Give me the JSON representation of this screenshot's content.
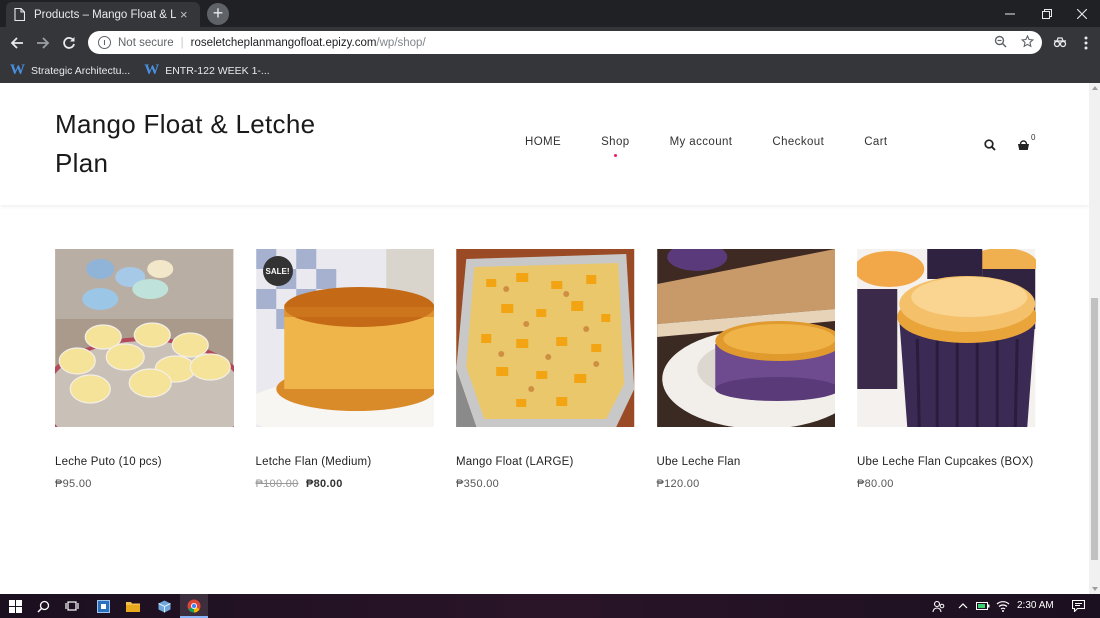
{
  "browser": {
    "tab_title": "Products – Mango Float & Letche Plan",
    "tab_close": "×",
    "new_tab": "+",
    "not_secure": "Not secure",
    "url_host": "roseletcheplanmangofloat.epizy.com",
    "url_path": "/wp/shop/",
    "bookmarks": [
      {
        "icon": "W",
        "label": "Strategic Architectu..."
      },
      {
        "icon": "W",
        "label": "ENTR-122 WEEK 1-..."
      }
    ]
  },
  "site": {
    "title": "Mango Float & Letche Plan",
    "nav": [
      {
        "label": "HOME",
        "active": false
      },
      {
        "label": "Shop",
        "active": true
      },
      {
        "label": "My account",
        "active": false
      },
      {
        "label": "Checkout",
        "active": false
      },
      {
        "label": "Cart",
        "active": false
      }
    ],
    "cart_count": "0"
  },
  "products": [
    {
      "name": "Leche Puto (10 pcs)",
      "price": "₱95.00",
      "sale": false
    },
    {
      "name": "Letche Flan (Medium)",
      "old_price": "₱100.00",
      "price": "₱80.00",
      "sale": true,
      "badge": "SALE!"
    },
    {
      "name": "Mango Float (LARGE)",
      "price": "₱350.00",
      "sale": false
    },
    {
      "name": "Ube Leche Flan",
      "price": "₱120.00",
      "sale": false
    },
    {
      "name": "Ube Leche Flan Cupcakes (BOX)",
      "price": "₱80.00",
      "sale": false
    }
  ],
  "taskbar": {
    "clock": "2:30 AM"
  },
  "colors": {
    "accent_dot": "#e91e63",
    "chrome_dark": "#202124",
    "chrome_toolbar": "#35363a"
  }
}
